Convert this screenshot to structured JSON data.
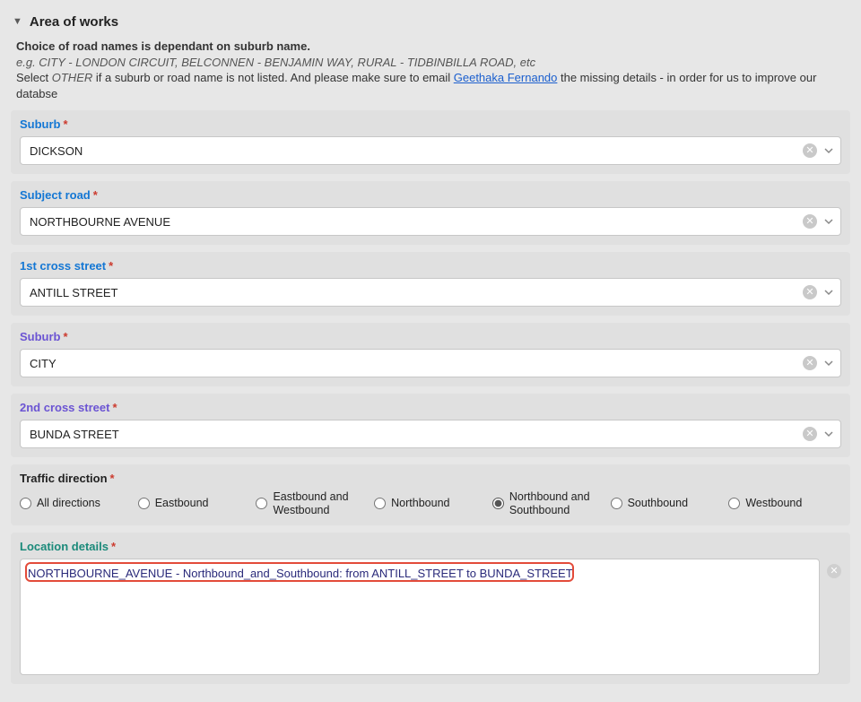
{
  "section": {
    "title": "Area of works"
  },
  "helper": {
    "line1_bold": "Choice of road names is dependant on suburb name.",
    "line2_italic": "e.g. CITY - LONDON CIRCUIT, BELCONNEN - BENJAMIN WAY, RURAL - TIDBINBILLA ROAD, etc",
    "line3_pre": "Select ",
    "line3_emph": "OTHER",
    "line3_mid": " if a suburb or road name is not listed. And please make sure to email ",
    "line3_link": "Geethaka Fernando",
    "line3_post": " the missing details - in order for us to improve our databse"
  },
  "fields": {
    "suburb1": {
      "label": "Suburb",
      "value": "DICKSON"
    },
    "subjectRoad": {
      "label": "Subject road",
      "value": "NORTHBOURNE AVENUE"
    },
    "cross1": {
      "label": "1st cross street",
      "value": "ANTILL STREET"
    },
    "suburb2": {
      "label": "Suburb",
      "value": "CITY"
    },
    "cross2": {
      "label": "2nd cross street",
      "value": "BUNDA STREET"
    }
  },
  "trafficDirection": {
    "label": "Traffic direction",
    "selected": "Northbound and Southbound",
    "options": [
      "All directions",
      "Eastbound",
      "Eastbound and Westbound",
      "Northbound",
      "Northbound and Southbound",
      "Southbound",
      "Westbound"
    ]
  },
  "locationDetails": {
    "label": "Location details",
    "value": "NORTHBOURNE_AVENUE - Northbound_and_Southbound: from ANTILL_STREET to BUNDA_STREET."
  }
}
